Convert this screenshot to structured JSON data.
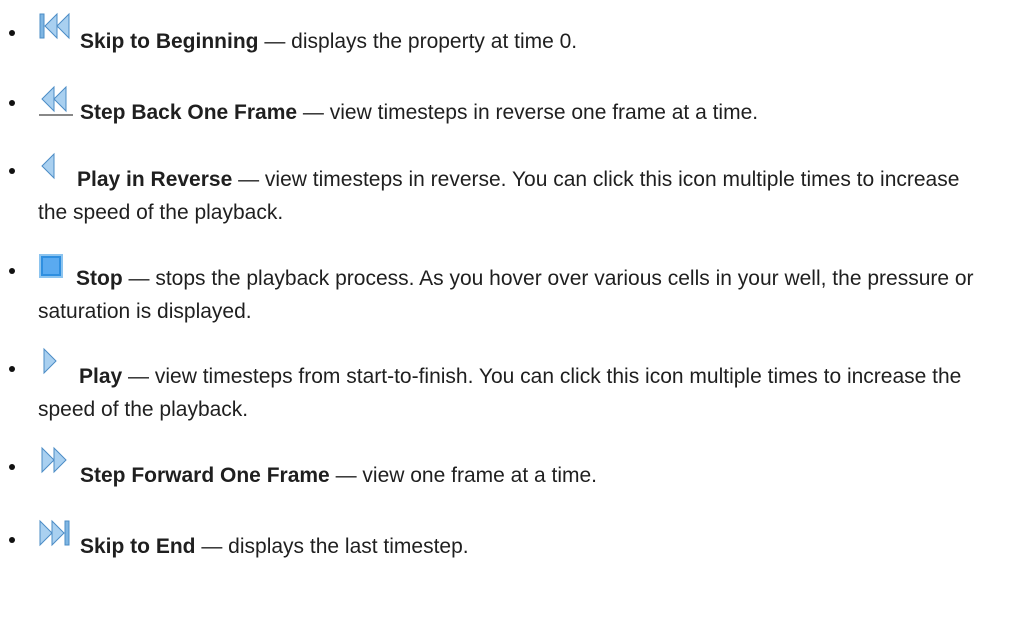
{
  "items": [
    {
      "icon": "skip-to-beginning-icon",
      "term": "Skip to Beginning",
      "description": " — displays the property at time 0."
    },
    {
      "icon": "step-back-one-frame-icon",
      "term": "Step Back One Frame",
      "description": " — view timesteps in reverse one frame at a time."
    },
    {
      "icon": "play-in-reverse-icon",
      "term": "Play in Reverse",
      "description": " — view timesteps in reverse. You can click this icon multiple times to increase the speed of the playback."
    },
    {
      "icon": "stop-icon",
      "term": "Stop",
      "description": " — stops the playback process. As you hover over various cells in your well, the pressure or saturation is displayed."
    },
    {
      "icon": "play-icon",
      "term": "Play",
      "description": " — view timesteps from start-to-finish. You can click this icon multiple times to increase the speed of the playback."
    },
    {
      "icon": "step-forward-one-frame-icon",
      "term": "Step Forward One Frame",
      "description": " — view one frame at a time."
    },
    {
      "icon": "skip-to-end-icon",
      "term": "Skip to End",
      "description": " — displays the last timestep."
    }
  ],
  "colors": {
    "icon_blue_light": "#b9d9f2",
    "icon_blue_dark": "#3f8fd0",
    "icon_stop": "#2f8fe0"
  }
}
